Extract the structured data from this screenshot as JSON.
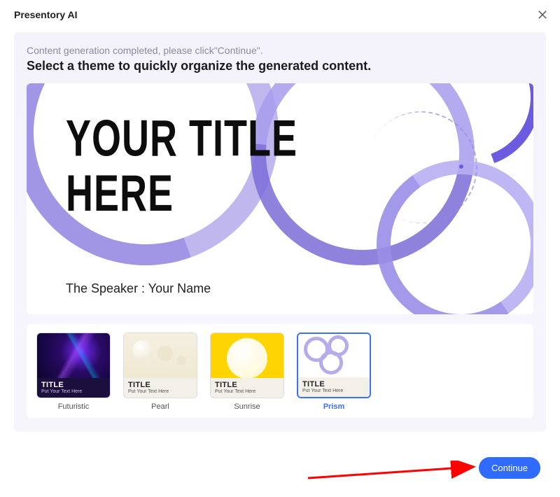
{
  "app_title": "Presentory AI",
  "status_text": "Content generation completed, please click\"Continue\".",
  "instruction_text": "Select a theme to quickly organize the generated content.",
  "preview": {
    "title": "YOUR TITLE\nHERE",
    "speaker_label": "The Speaker :  Your Name"
  },
  "thumb_caption": {
    "title": "TITLE",
    "subtitle": "Put Your Text Here"
  },
  "themes": [
    {
      "id": "futuristic",
      "label": "Futuristic",
      "selected": false
    },
    {
      "id": "pearl",
      "label": "Pearl",
      "selected": false
    },
    {
      "id": "sunrise",
      "label": "Sunrise",
      "selected": false
    },
    {
      "id": "prism",
      "label": "Prism",
      "selected": true
    }
  ],
  "continue_label": "Continue",
  "colors": {
    "accent": "#2f6bff",
    "ring_light": "#b0a6ea",
    "ring_dark": "#7b6dd8"
  }
}
